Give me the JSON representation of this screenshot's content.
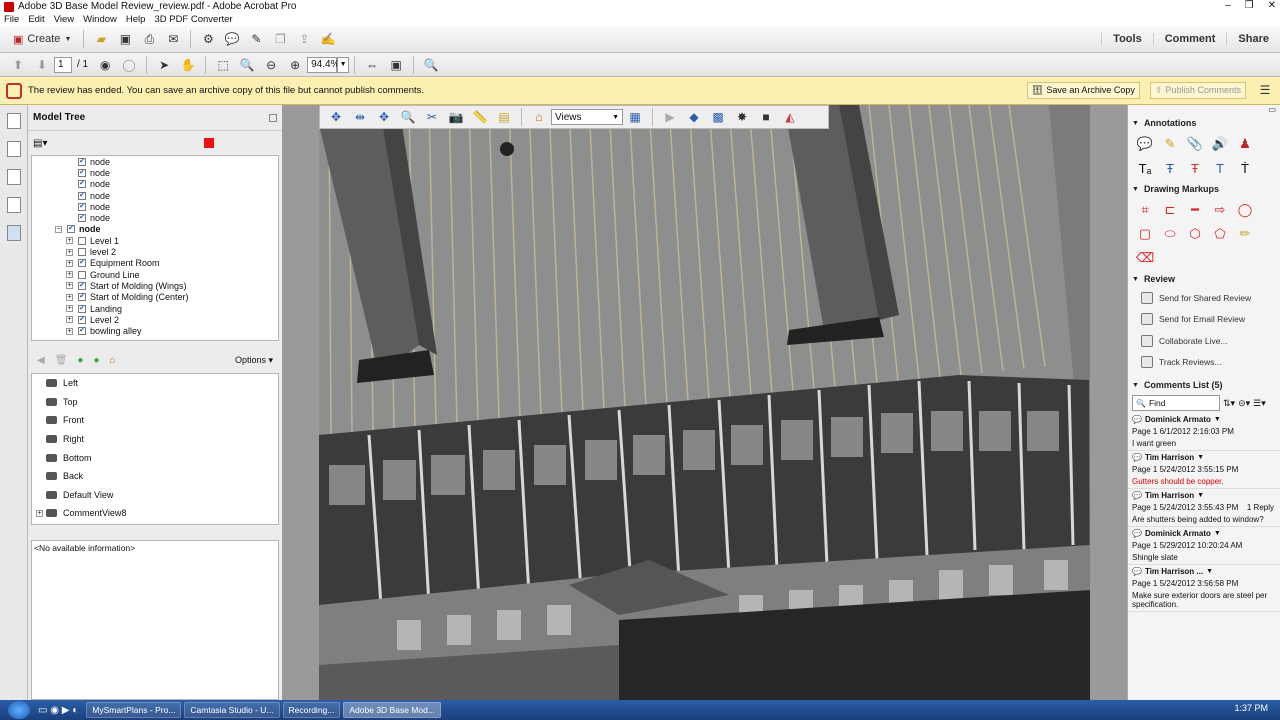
{
  "window": {
    "title": "Adobe 3D Base Model Review_review.pdf - Adobe Acrobat Pro",
    "controls": [
      "–",
      "❐",
      "✕"
    ]
  },
  "menu": [
    "File",
    "Edit",
    "View",
    "Window",
    "Help",
    "3D PDF Converter"
  ],
  "toolbar": {
    "create_label": "Create",
    "right_tabs": [
      "Tools",
      "Comment",
      "Share"
    ]
  },
  "nav": {
    "page_current": "1",
    "page_total": "/ 1",
    "zoom": "94.4%"
  },
  "review_bar": {
    "message": "The review has ended. You can save an archive copy of this file but cannot publish comments.",
    "save_archive_label": "Save an Archive Copy",
    "publish_label": "Publish Comments"
  },
  "model_tree": {
    "title": "Model Tree",
    "nodes": [
      {
        "label": "node",
        "indent": 2,
        "expand": false,
        "checked": true,
        "bold": false
      },
      {
        "label": "node",
        "indent": 2,
        "expand": false,
        "checked": true,
        "bold": false
      },
      {
        "label": "node",
        "indent": 2,
        "expand": false,
        "checked": true,
        "bold": false
      },
      {
        "label": "node",
        "indent": 2,
        "expand": false,
        "checked": true,
        "bold": false
      },
      {
        "label": "node",
        "indent": 2,
        "expand": false,
        "checked": true,
        "bold": false
      },
      {
        "label": "node",
        "indent": 2,
        "expand": false,
        "checked": true,
        "bold": false
      },
      {
        "label": "node",
        "indent": 1,
        "expand": "−",
        "checked": true,
        "bold": true
      },
      {
        "label": "Level 1",
        "indent": 2,
        "expand": "+",
        "checked": false,
        "bold": false
      },
      {
        "label": "level 2",
        "indent": 2,
        "expand": "+",
        "checked": false,
        "bold": false
      },
      {
        "label": "Equipment Room",
        "indent": 2,
        "expand": "+",
        "checked": true,
        "bold": false
      },
      {
        "label": "Ground Line",
        "indent": 2,
        "expand": "+",
        "checked": false,
        "bold": false
      },
      {
        "label": "Start of Molding (Wings)",
        "indent": 2,
        "expand": "+",
        "checked": true,
        "bold": false
      },
      {
        "label": "Start of Molding (Center)",
        "indent": 2,
        "expand": "+",
        "checked": true,
        "bold": false
      },
      {
        "label": "Landing",
        "indent": 2,
        "expand": "+",
        "checked": true,
        "bold": false
      },
      {
        "label": "Level 2",
        "indent": 2,
        "expand": "+",
        "checked": true,
        "bold": false
      },
      {
        "label": "bowling alley",
        "indent": 2,
        "expand": "+",
        "checked": true,
        "bold": false
      }
    ]
  },
  "views_panel": {
    "options_label": "Options",
    "views": [
      "Left",
      "Top",
      "Front",
      "Right",
      "Bottom",
      "Back",
      "Default View"
    ],
    "comment_view": "CommentView8"
  },
  "info_text": "<No available information>",
  "viewer_toolbar": {
    "views_dropdown": "Views"
  },
  "right_panel": {
    "annotations_title": "Annotations",
    "drawing_title": "Drawing Markups",
    "review_title": "Review",
    "review_items": [
      "Send for Shared Review",
      "Send for Email Review",
      "Collaborate Live...",
      "Track Reviews..."
    ],
    "comments_title": "Comments List (5)",
    "find_placeholder": "Find",
    "comments": [
      {
        "author": "Dominick Armato",
        "meta": "Page 1  6/1/2012 2:16:03 PM",
        "reply": "",
        "body": "I want green",
        "red": false
      },
      {
        "author": "Tim Harrison",
        "meta": "Page 1  5/24/2012 3:55:15 PM",
        "reply": "",
        "body": "Gutters should be copper.",
        "red": true
      },
      {
        "author": "Tim Harrison",
        "meta": "Page 1  5/24/2012 3:55:43 PM",
        "reply": "1 Reply",
        "body": "Are shutters being added to window?",
        "red": false
      },
      {
        "author": "Dominick Armato",
        "meta": "Page 1  5/29/2012 10:20:24 AM",
        "reply": "",
        "body": "Shingle slate",
        "red": false
      },
      {
        "author": "Tim Harrison ...",
        "meta": "Page 1  5/24/2012 3:56:58 PM",
        "reply": "",
        "body": "Make sure exterior doors are steel per specification.",
        "red": false
      }
    ]
  },
  "taskbar": {
    "items": [
      "MySmartPlans - Pro...",
      "Camtasia Studio - U...",
      "Recording...",
      "Adobe 3D Base Mod..."
    ],
    "active": 3,
    "clock": "1:37 PM"
  },
  "colors": {
    "review_bar": "#fbf0b2",
    "roof": "#8c8c8c",
    "taskbar": "#1b3f7c"
  }
}
